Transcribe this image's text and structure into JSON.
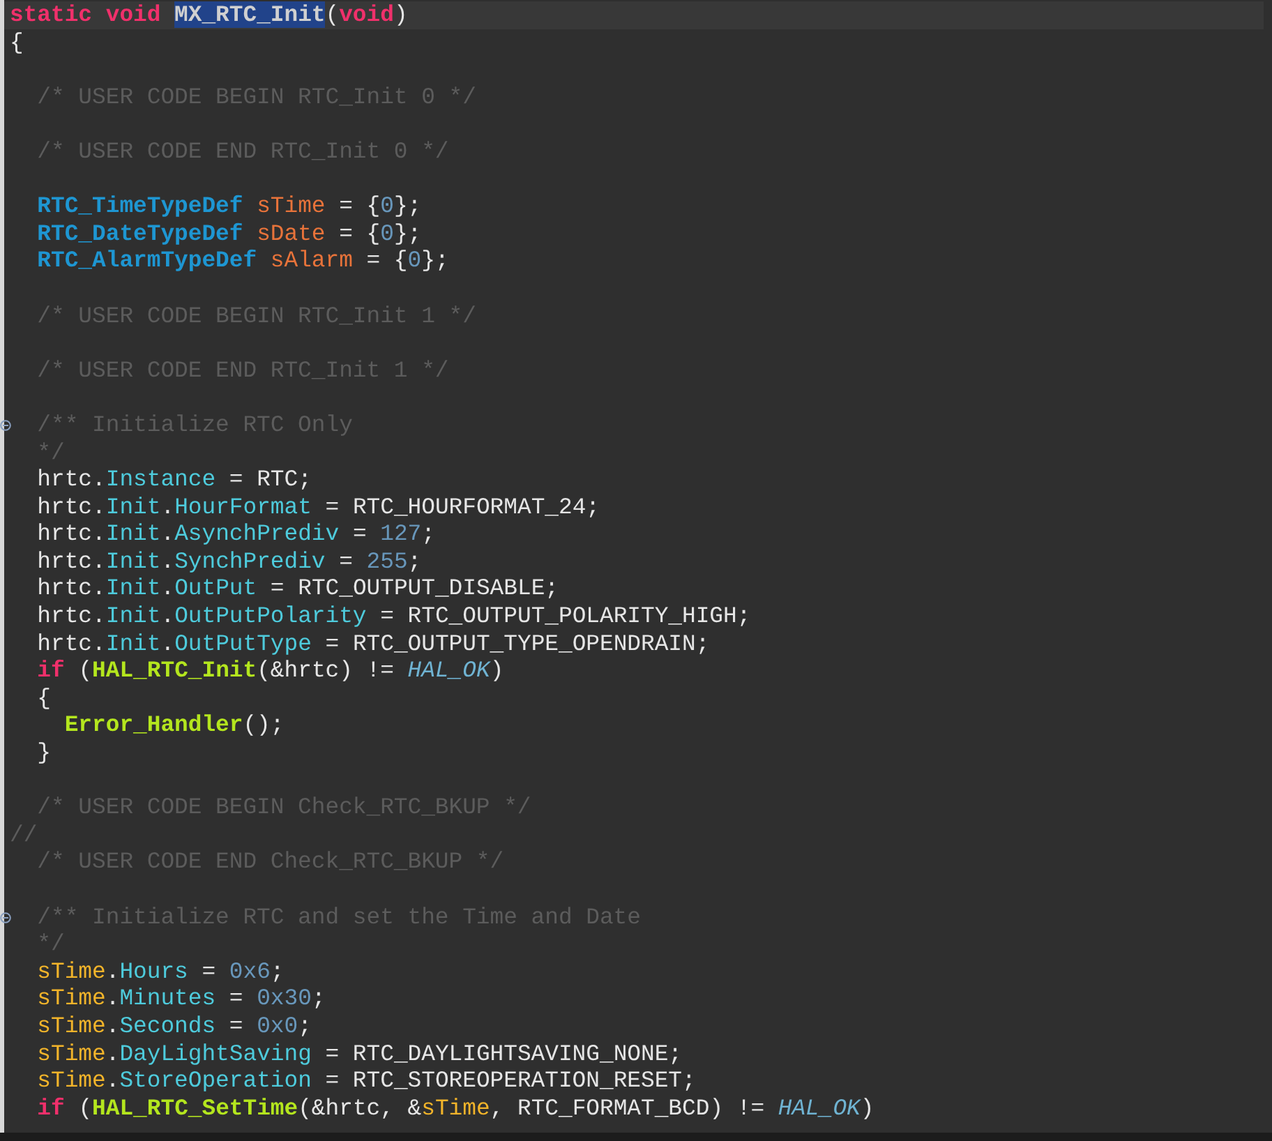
{
  "editor": {
    "lines": [
      {
        "current": true,
        "fold": false,
        "tokens": [
          {
            "kind": "keyword",
            "text": "static void "
          },
          {
            "kind": "selection",
            "text": "MX_RTC_Init"
          },
          {
            "kind": "plain",
            "text": "("
          },
          {
            "kind": "keyword",
            "text": "void"
          },
          {
            "kind": "plain",
            "text": ")"
          }
        ]
      },
      {
        "current": false,
        "fold": false,
        "tokens": [
          {
            "kind": "plain",
            "text": "{"
          }
        ]
      },
      {
        "current": false,
        "fold": false
      },
      {
        "current": false,
        "fold": false,
        "tokens": [
          {
            "kind": "comment",
            "text": "  /* USER CODE BEGIN RTC_Init 0 */"
          }
        ]
      },
      {
        "current": false,
        "fold": false
      },
      {
        "current": false,
        "fold": false,
        "tokens": [
          {
            "kind": "comment",
            "text": "  /* USER CODE END RTC_Init 0 */"
          }
        ]
      },
      {
        "current": false,
        "fold": false
      },
      {
        "current": false,
        "fold": false,
        "tokens": [
          {
            "kind": "type",
            "text": "  RTC_TimeTypeDef "
          },
          {
            "kind": "declaration",
            "text": "sTime"
          },
          {
            "kind": "plain",
            "text": " = {"
          },
          {
            "kind": "number",
            "text": "0"
          },
          {
            "kind": "plain",
            "text": "};"
          }
        ]
      },
      {
        "current": false,
        "fold": false,
        "tokens": [
          {
            "kind": "type",
            "text": "  RTC_DateTypeDef "
          },
          {
            "kind": "declaration",
            "text": "sDate"
          },
          {
            "kind": "plain",
            "text": " = {"
          },
          {
            "kind": "number",
            "text": "0"
          },
          {
            "kind": "plain",
            "text": "};"
          }
        ]
      },
      {
        "current": false,
        "fold": false,
        "tokens": [
          {
            "kind": "type",
            "text": "  RTC_AlarmTypeDef "
          },
          {
            "kind": "declaration",
            "text": "sAlarm"
          },
          {
            "kind": "plain",
            "text": " = {"
          },
          {
            "kind": "number",
            "text": "0"
          },
          {
            "kind": "plain",
            "text": "};"
          }
        ]
      },
      {
        "current": false,
        "fold": false
      },
      {
        "current": false,
        "fold": false,
        "tokens": [
          {
            "kind": "comment",
            "text": "  /* USER CODE BEGIN RTC_Init 1 */"
          }
        ]
      },
      {
        "current": false,
        "fold": false
      },
      {
        "current": false,
        "fold": false,
        "tokens": [
          {
            "kind": "comment",
            "text": "  /* USER CODE END RTC_Init 1 */"
          }
        ]
      },
      {
        "current": false,
        "fold": false
      },
      {
        "current": false,
        "fold": true,
        "tokens": [
          {
            "kind": "comment",
            "text": "  /** Initialize RTC Only"
          }
        ]
      },
      {
        "current": false,
        "fold": false,
        "tokens": [
          {
            "kind": "comment",
            "text": "  */"
          }
        ]
      },
      {
        "current": false,
        "fold": false,
        "tokens": [
          {
            "kind": "plain",
            "text": "  hrtc."
          },
          {
            "kind": "field",
            "text": "Instance"
          },
          {
            "kind": "plain",
            "text": " = RTC;"
          }
        ]
      },
      {
        "current": false,
        "fold": false,
        "tokens": [
          {
            "kind": "plain",
            "text": "  hrtc."
          },
          {
            "kind": "field",
            "text": "Init"
          },
          {
            "kind": "plain",
            "text": "."
          },
          {
            "kind": "field",
            "text": "HourFormat"
          },
          {
            "kind": "plain",
            "text": " = RTC_HOURFORMAT_24;"
          }
        ]
      },
      {
        "current": false,
        "fold": false,
        "tokens": [
          {
            "kind": "plain",
            "text": "  hrtc."
          },
          {
            "kind": "field",
            "text": "Init"
          },
          {
            "kind": "plain",
            "text": "."
          },
          {
            "kind": "field",
            "text": "AsynchPrediv"
          },
          {
            "kind": "plain",
            "text": " = "
          },
          {
            "kind": "number",
            "text": "127"
          },
          {
            "kind": "plain",
            "text": ";"
          }
        ]
      },
      {
        "current": false,
        "fold": false,
        "tokens": [
          {
            "kind": "plain",
            "text": "  hrtc."
          },
          {
            "kind": "field",
            "text": "Init"
          },
          {
            "kind": "plain",
            "text": "."
          },
          {
            "kind": "field",
            "text": "SynchPrediv"
          },
          {
            "kind": "plain",
            "text": " = "
          },
          {
            "kind": "number",
            "text": "255"
          },
          {
            "kind": "plain",
            "text": ";"
          }
        ]
      },
      {
        "current": false,
        "fold": false,
        "tokens": [
          {
            "kind": "plain",
            "text": "  hrtc."
          },
          {
            "kind": "field",
            "text": "Init"
          },
          {
            "kind": "plain",
            "text": "."
          },
          {
            "kind": "field",
            "text": "OutPut"
          },
          {
            "kind": "plain",
            "text": " = RTC_OUTPUT_DISABLE;"
          }
        ]
      },
      {
        "current": false,
        "fold": false,
        "tokens": [
          {
            "kind": "plain",
            "text": "  hrtc."
          },
          {
            "kind": "field",
            "text": "Init"
          },
          {
            "kind": "plain",
            "text": "."
          },
          {
            "kind": "field",
            "text": "OutPutPolarity"
          },
          {
            "kind": "plain",
            "text": " = RTC_OUTPUT_POLARITY_HIGH;"
          }
        ]
      },
      {
        "current": false,
        "fold": false,
        "tokens": [
          {
            "kind": "plain",
            "text": "  hrtc."
          },
          {
            "kind": "field",
            "text": "Init"
          },
          {
            "kind": "plain",
            "text": "."
          },
          {
            "kind": "field",
            "text": "OutPutType"
          },
          {
            "kind": "plain",
            "text": " = RTC_OUTPUT_TYPE_OPENDRAIN;"
          }
        ]
      },
      {
        "current": false,
        "fold": false,
        "tokens": [
          {
            "kind": "keyword",
            "text": "  if"
          },
          {
            "kind": "plain",
            "text": " ("
          },
          {
            "kind": "function",
            "text": "HAL_RTC_Init"
          },
          {
            "kind": "plain",
            "text": "(&hrtc) != "
          },
          {
            "kind": "macro",
            "text": "HAL_OK"
          },
          {
            "kind": "plain",
            "text": ")"
          }
        ]
      },
      {
        "current": false,
        "fold": false,
        "tokens": [
          {
            "kind": "plain",
            "text": "  {"
          }
        ]
      },
      {
        "current": false,
        "fold": false,
        "tokens": [
          {
            "kind": "function",
            "text": "    Error_Handler"
          },
          {
            "kind": "plain",
            "text": "();"
          }
        ]
      },
      {
        "current": false,
        "fold": false,
        "tokens": [
          {
            "kind": "plain",
            "text": "  }"
          }
        ]
      },
      {
        "current": false,
        "fold": false
      },
      {
        "current": false,
        "fold": false,
        "tokens": [
          {
            "kind": "comment",
            "text": "  /* USER CODE BEGIN Check_RTC_BKUP */"
          }
        ]
      },
      {
        "current": false,
        "fold": false,
        "tokens": [
          {
            "kind": "comment",
            "text": "//"
          }
        ]
      },
      {
        "current": false,
        "fold": false,
        "tokens": [
          {
            "kind": "comment",
            "text": "  /* USER CODE END Check_RTC_BKUP */"
          }
        ]
      },
      {
        "current": false,
        "fold": false
      },
      {
        "current": false,
        "fold": true,
        "tokens": [
          {
            "kind": "comment",
            "text": "  /** Initialize RTC and set the Time and Date"
          }
        ]
      },
      {
        "current": false,
        "fold": false,
        "tokens": [
          {
            "kind": "comment",
            "text": "  */"
          }
        ]
      },
      {
        "current": false,
        "fold": false,
        "tokens": [
          {
            "kind": "variable",
            "text": "  sTime"
          },
          {
            "kind": "plain",
            "text": "."
          },
          {
            "kind": "field",
            "text": "Hours"
          },
          {
            "kind": "plain",
            "text": " = "
          },
          {
            "kind": "number",
            "text": "0x6"
          },
          {
            "kind": "plain",
            "text": ";"
          }
        ]
      },
      {
        "current": false,
        "fold": false,
        "tokens": [
          {
            "kind": "variable",
            "text": "  sTime"
          },
          {
            "kind": "plain",
            "text": "."
          },
          {
            "kind": "field",
            "text": "Minutes"
          },
          {
            "kind": "plain",
            "text": " = "
          },
          {
            "kind": "number",
            "text": "0x30"
          },
          {
            "kind": "plain",
            "text": ";"
          }
        ]
      },
      {
        "current": false,
        "fold": false,
        "tokens": [
          {
            "kind": "variable",
            "text": "  sTime"
          },
          {
            "kind": "plain",
            "text": "."
          },
          {
            "kind": "field",
            "text": "Seconds"
          },
          {
            "kind": "plain",
            "text": " = "
          },
          {
            "kind": "number",
            "text": "0x0"
          },
          {
            "kind": "plain",
            "text": ";"
          }
        ]
      },
      {
        "current": false,
        "fold": false,
        "tokens": [
          {
            "kind": "variable",
            "text": "  sTime"
          },
          {
            "kind": "plain",
            "text": "."
          },
          {
            "kind": "field",
            "text": "DayLightSaving"
          },
          {
            "kind": "plain",
            "text": " = RTC_DAYLIGHTSAVING_NONE;"
          }
        ]
      },
      {
        "current": false,
        "fold": false,
        "tokens": [
          {
            "kind": "variable",
            "text": "  sTime"
          },
          {
            "kind": "plain",
            "text": "."
          },
          {
            "kind": "field",
            "text": "StoreOperation"
          },
          {
            "kind": "plain",
            "text": " = RTC_STOREOPERATION_RESET;"
          }
        ]
      },
      {
        "current": false,
        "fold": false,
        "tokens": [
          {
            "kind": "keyword",
            "text": "  if"
          },
          {
            "kind": "plain",
            "text": " ("
          },
          {
            "kind": "function",
            "text": "HAL_RTC_SetTime"
          },
          {
            "kind": "plain",
            "text": "(&hrtc, &"
          },
          {
            "kind": "variable",
            "text": "sTime"
          },
          {
            "kind": "plain",
            "text": ", RTC_FORMAT_BCD) != "
          },
          {
            "kind": "macro",
            "text": "HAL_OK"
          },
          {
            "kind": "plain",
            "text": ")"
          }
        ]
      }
    ]
  }
}
